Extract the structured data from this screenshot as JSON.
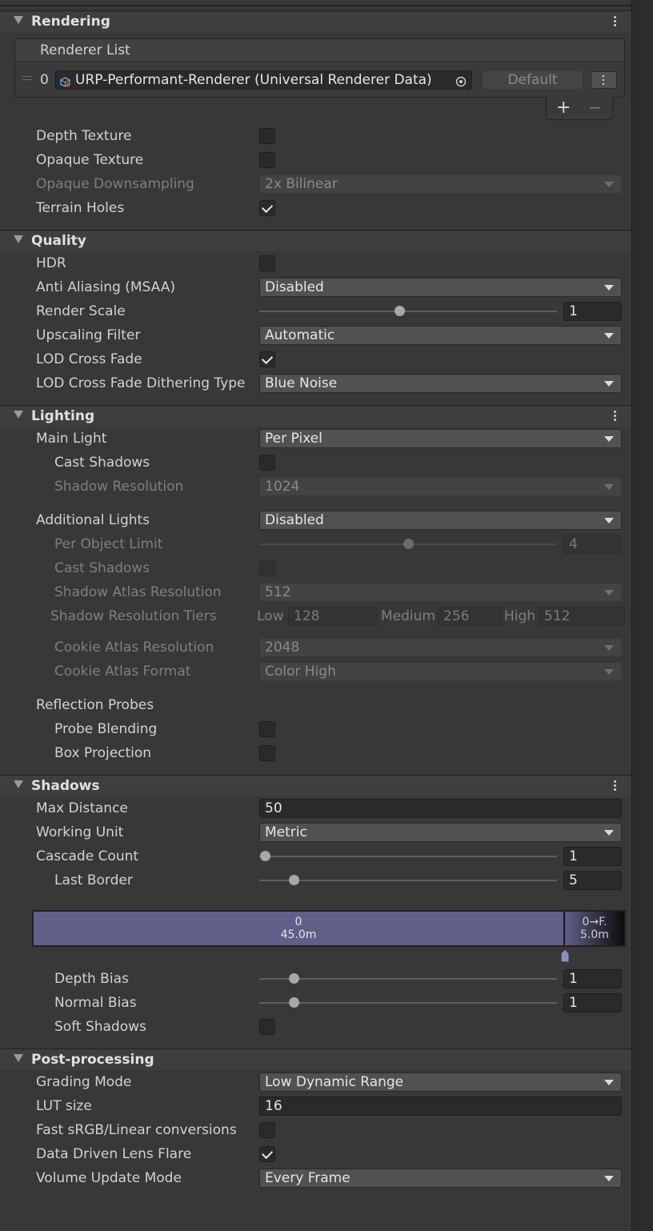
{
  "rendering": {
    "title": "Rendering",
    "renderer_list_label": "Renderer List",
    "renderer": {
      "index": "0",
      "name": "URP-Performant-Renderer (Universal Renderer Data)",
      "default_label": "Default"
    },
    "add_label": "+",
    "remove_label": "−",
    "depth_texture": {
      "label": "Depth Texture",
      "checked": false
    },
    "opaque_texture": {
      "label": "Opaque Texture",
      "checked": false
    },
    "opaque_downsampling": {
      "label": "Opaque Downsampling",
      "value": "2x Bilinear"
    },
    "terrain_holes": {
      "label": "Terrain Holes",
      "checked": true
    }
  },
  "quality": {
    "title": "Quality",
    "hdr": {
      "label": "HDR",
      "checked": false
    },
    "anti_aliasing": {
      "label": "Anti Aliasing (MSAA)",
      "value": "Disabled"
    },
    "render_scale": {
      "label": "Render Scale",
      "value": "1",
      "slider_fraction": 0.47
    },
    "upscaling_filter": {
      "label": "Upscaling Filter",
      "value": "Automatic"
    },
    "lod_cross_fade": {
      "label": "LOD Cross Fade",
      "checked": true
    },
    "lod_dithering": {
      "label": "LOD Cross Fade Dithering Type",
      "value": "Blue Noise"
    }
  },
  "lighting": {
    "title": "Lighting",
    "main_light": {
      "label": "Main Light",
      "value": "Per Pixel"
    },
    "cast_shadows": {
      "label": "Cast Shadows",
      "checked": false
    },
    "shadow_resolution": {
      "label": "Shadow Resolution",
      "value": "1024"
    },
    "additional_lights": {
      "label": "Additional Lights",
      "value": "Disabled"
    },
    "per_object_limit": {
      "label": "Per Object Limit",
      "value": "4",
      "slider_fraction": 0.5
    },
    "add_cast_shadows": {
      "label": "Cast Shadows",
      "checked": false
    },
    "shadow_atlas_resolution": {
      "label": "Shadow Atlas Resolution",
      "value": "512"
    },
    "shadow_tiers": {
      "label": "Shadow Resolution Tiers",
      "low_label": "Low",
      "low_value": "128",
      "medium_label": "Medium",
      "medium_value": "256",
      "high_label": "High",
      "high_value": "512"
    },
    "cookie_atlas_resolution": {
      "label": "Cookie Atlas Resolution",
      "value": "2048"
    },
    "cookie_atlas_format": {
      "label": "Cookie Atlas Format",
      "value": "Color High"
    },
    "reflection_probes": {
      "label": "Reflection Probes"
    },
    "probe_blending": {
      "label": "Probe Blending",
      "checked": false
    },
    "box_projection": {
      "label": "Box Projection",
      "checked": false
    }
  },
  "shadows": {
    "title": "Shadows",
    "max_distance": {
      "label": "Max Distance",
      "value": "50"
    },
    "working_unit": {
      "label": "Working Unit",
      "value": "Metric"
    },
    "cascade_count": {
      "label": "Cascade Count",
      "value": "1",
      "slider_fraction": 0.02
    },
    "last_border": {
      "label": "Last Border",
      "value": "5",
      "slider_fraction": 0.115
    },
    "cascade_bar": {
      "seg0_index": "0",
      "seg0_distance": "45.0m",
      "seg1_index": "0→F.",
      "seg1_distance": "5.0m",
      "split_fraction": 0.9
    },
    "depth_bias": {
      "label": "Depth Bias",
      "value": "1",
      "slider_fraction": 0.115
    },
    "normal_bias": {
      "label": "Normal Bias",
      "value": "1",
      "slider_fraction": 0.115
    },
    "soft_shadows": {
      "label": "Soft Shadows",
      "checked": false
    }
  },
  "post_processing": {
    "title": "Post-processing",
    "grading_mode": {
      "label": "Grading Mode",
      "value": "Low Dynamic Range"
    },
    "lut_size": {
      "label": "LUT size",
      "value": "16"
    },
    "fast_srgb": {
      "label": "Fast sRGB/Linear conversions",
      "checked": false
    },
    "lens_flare": {
      "label": "Data Driven Lens Flare",
      "checked": true
    },
    "volume_update": {
      "label": "Volume Update Mode",
      "value": "Every Frame"
    }
  },
  "colors": {
    "background": "#383838",
    "cascade_fill": "#5f5f87",
    "cascade_handle": "#8c8cc0"
  }
}
